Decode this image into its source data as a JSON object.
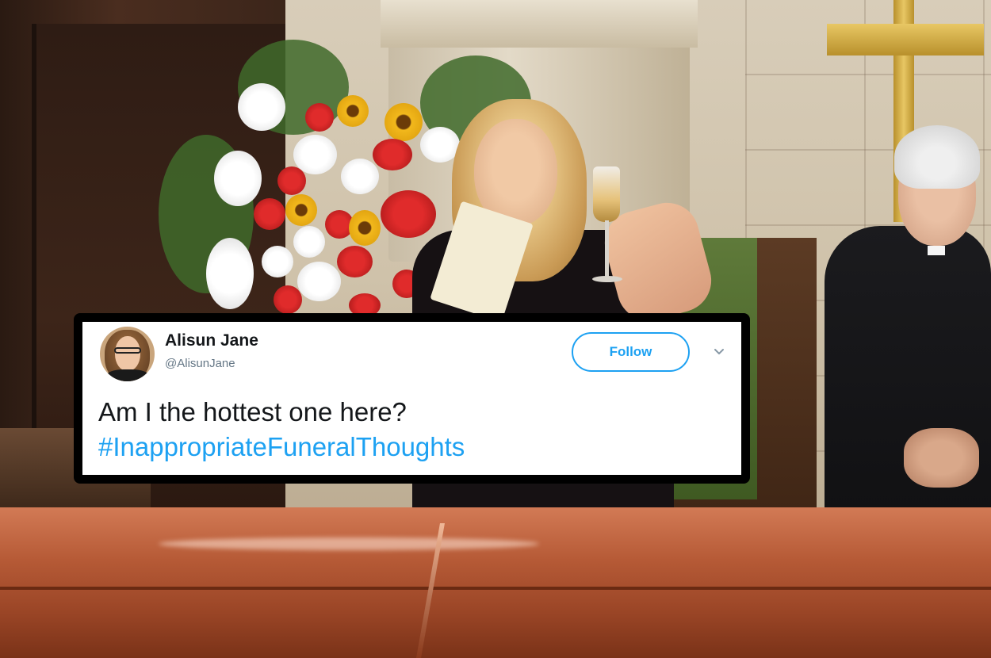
{
  "tweet": {
    "display_name": "Alisun Jane",
    "handle": "@AlisunJane",
    "follow_label": "Follow",
    "text": "Am I the hottest one here?",
    "hashtag": "#InappropriateFuneralThoughts",
    "avatar_icon": "user-avatar-photo",
    "chevron_icon": "chevron-down-icon"
  },
  "colors": {
    "twitter_blue": "#1da1f2",
    "text_dark": "#14171a",
    "handle_gray": "#657786"
  }
}
